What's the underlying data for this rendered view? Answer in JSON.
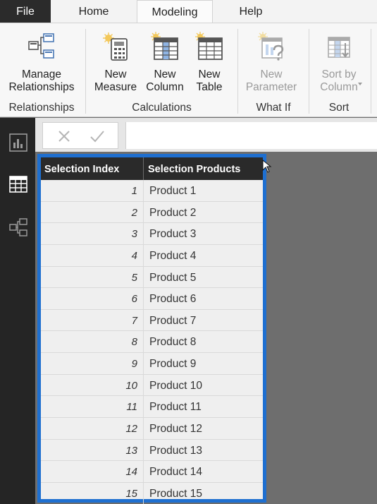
{
  "menu": {
    "tabs": [
      {
        "label": "File"
      },
      {
        "label": "Home"
      },
      {
        "label": "Modeling"
      },
      {
        "label": "Help"
      }
    ]
  },
  "ribbon": {
    "groups": [
      {
        "label": "Relationships"
      },
      {
        "label": "Calculations"
      },
      {
        "label": "What If"
      },
      {
        "label": "Sort"
      }
    ],
    "buttons": {
      "manage_relationships": "Manage\nRelationships",
      "new_measure": "New\nMeasure",
      "new_column": "New\nColumn",
      "new_table": "New\nTable",
      "new_parameter": "New\nParameter",
      "sort_by_column": "Sort by\nColumn"
    }
  },
  "table": {
    "columns": [
      "Selection Index",
      "Selection Products"
    ],
    "rows": [
      {
        "index": "1",
        "product": "Product 1"
      },
      {
        "index": "2",
        "product": "Product 2"
      },
      {
        "index": "3",
        "product": "Product 3"
      },
      {
        "index": "4",
        "product": "Product 4"
      },
      {
        "index": "5",
        "product": "Product 5"
      },
      {
        "index": "6",
        "product": "Product 6"
      },
      {
        "index": "7",
        "product": "Product 7"
      },
      {
        "index": "8",
        "product": "Product 8"
      },
      {
        "index": "9",
        "product": "Product 9"
      },
      {
        "index": "10",
        "product": "Product 10"
      },
      {
        "index": "11",
        "product": "Product 11"
      },
      {
        "index": "12",
        "product": "Product 12"
      },
      {
        "index": "13",
        "product": "Product 13"
      },
      {
        "index": "14",
        "product": "Product 14"
      },
      {
        "index": "15",
        "product": "Product 15"
      }
    ]
  },
  "colors": {
    "accent": "#1e6fd0",
    "header_bg": "#2a2a2a",
    "nav_bg": "#252525",
    "canvas_bg": "#6e6e6e"
  },
  "icons": {
    "manage_relationships": "relationships-icon",
    "new_measure": "calculator-icon",
    "new_column": "table-column-icon",
    "new_table": "table-icon",
    "new_parameter": "parameter-icon",
    "sort_by_column": "sort-icon",
    "report_view": "bar-chart-icon",
    "data_view": "grid-icon",
    "model_view": "model-icon",
    "cancel": "close-icon",
    "commit": "check-icon"
  }
}
